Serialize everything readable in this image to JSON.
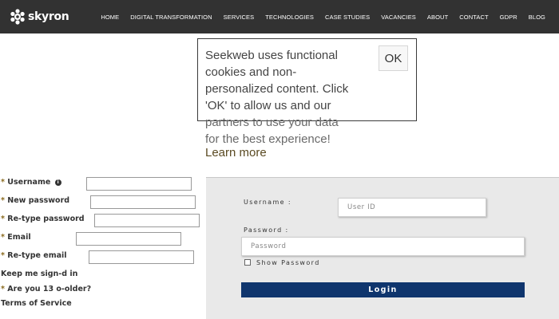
{
  "brand": {
    "name": "skyron"
  },
  "nav": {
    "items": [
      "HOME",
      "DIGITAL TRANSFORMATION",
      "SERVICES",
      "TECHNOLOGIES",
      "CASE STUDIES",
      "VACANCIES",
      "ABOUT",
      "CONTACT",
      "GDPR",
      "BLOG"
    ]
  },
  "cookie": {
    "message_line1": "Seekweb uses functional",
    "message_line2": "cookies and non-",
    "message_line3": "personalized content. Click",
    "message_line4": "'OK' to allow us and our",
    "message_line5": "partners to use your data",
    "message_line6": "for the best experience!",
    "learn_more": "Learn more",
    "ok_label": "OK"
  },
  "register": {
    "username_label": "Username",
    "new_password_label": "New password",
    "retype_password_label": "Re-type password",
    "email_label": "Email",
    "retype_email_label": "Re-type email",
    "keep_signed_in_label": "Keep me sign‐d in",
    "age_label": "Are you 13 o‐older?",
    "terms_label": "Terms of Service",
    "required_marker": "*"
  },
  "login": {
    "username_label": "Username :",
    "username_placeholder": "User ID",
    "password_label": "Password :",
    "password_placeholder": "Password",
    "show_password_label": "Show Password",
    "login_button": "Login"
  },
  "colors": {
    "topbar": "#323232",
    "login_button": "#0f356d",
    "required_star": "#8a6a1e"
  }
}
